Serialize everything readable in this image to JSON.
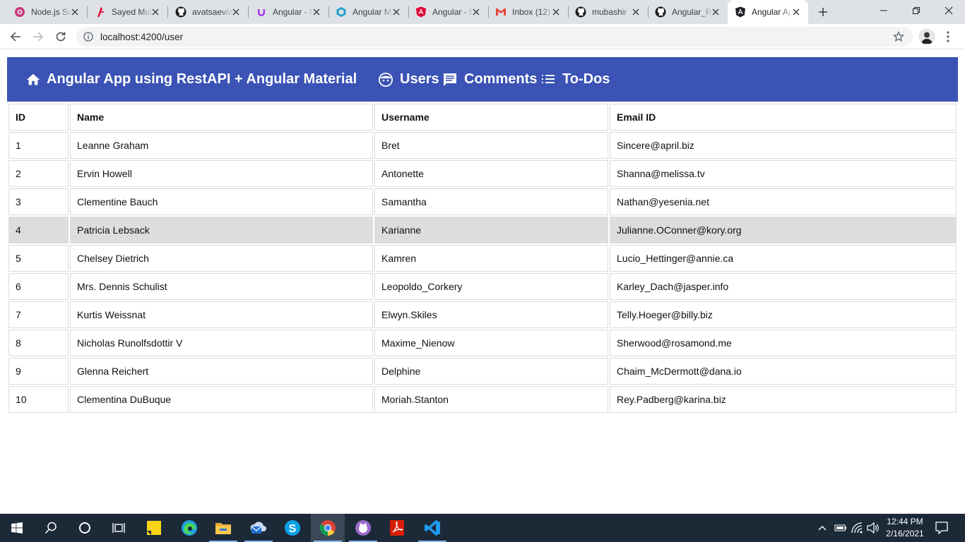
{
  "browser": {
    "tabs": [
      {
        "title": "Node.js Sequelize",
        "icon": "nodejs-tutorial-icon"
      },
      {
        "title": "Sayed Mubashir",
        "icon": "angular-tutorial-icon"
      },
      {
        "title": "avatsaev/angular",
        "icon": "github-icon"
      },
      {
        "title": "Angular - Udemy",
        "icon": "udemy-icon"
      },
      {
        "title": "Angular Material",
        "icon": "angular-material-icon"
      },
      {
        "title": "Angular - Docs",
        "icon": "angular-icon"
      },
      {
        "title": "Inbox (12)",
        "icon": "gmail-icon"
      },
      {
        "title": "mubashir",
        "icon": "github-icon"
      },
      {
        "title": "Angular_RestAPI",
        "icon": "github-icon"
      },
      {
        "title": "Angular App",
        "icon": "angular-a-icon",
        "active": true
      }
    ],
    "url": "localhost:4200/user"
  },
  "app": {
    "title": "Angular App using RestAPI + Angular Material",
    "nav": [
      {
        "label": "Users",
        "icon": "face-icon"
      },
      {
        "label": "Comments",
        "icon": "comment-icon"
      },
      {
        "label": "To-Dos",
        "icon": "list-icon"
      }
    ],
    "accent": "#3a53b5"
  },
  "table": {
    "headers": [
      "ID",
      "Name",
      "Username",
      "Email ID"
    ],
    "highlight_row": 3,
    "rows": [
      [
        "1",
        "Leanne Graham",
        "Bret",
        "Sincere@april.biz"
      ],
      [
        "2",
        "Ervin Howell",
        "Antonette",
        "Shanna@melissa.tv"
      ],
      [
        "3",
        "Clementine Bauch",
        "Samantha",
        "Nathan@yesenia.net"
      ],
      [
        "4",
        "Patricia Lebsack",
        "Karianne",
        "Julianne.OConner@kory.org"
      ],
      [
        "5",
        "Chelsey Dietrich",
        "Kamren",
        "Lucio_Hettinger@annie.ca"
      ],
      [
        "6",
        "Mrs. Dennis Schulist",
        "Leopoldo_Corkery",
        "Karley_Dach@jasper.info"
      ],
      [
        "7",
        "Kurtis Weissnat",
        "Elwyn.Skiles",
        "Telly.Hoeger@billy.biz"
      ],
      [
        "8",
        "Nicholas Runolfsdottir V",
        "Maxime_Nienow",
        "Sherwood@rosamond.me"
      ],
      [
        "9",
        "Glenna Reichert",
        "Delphine",
        "Chaim_McDermott@dana.io"
      ],
      [
        "10",
        "Clementina DuBuque",
        "Moriah.Stanton",
        "Rey.Padberg@karina.biz"
      ]
    ]
  },
  "taskbar": {
    "time": "12:44 PM",
    "date": "2/16/2021"
  }
}
